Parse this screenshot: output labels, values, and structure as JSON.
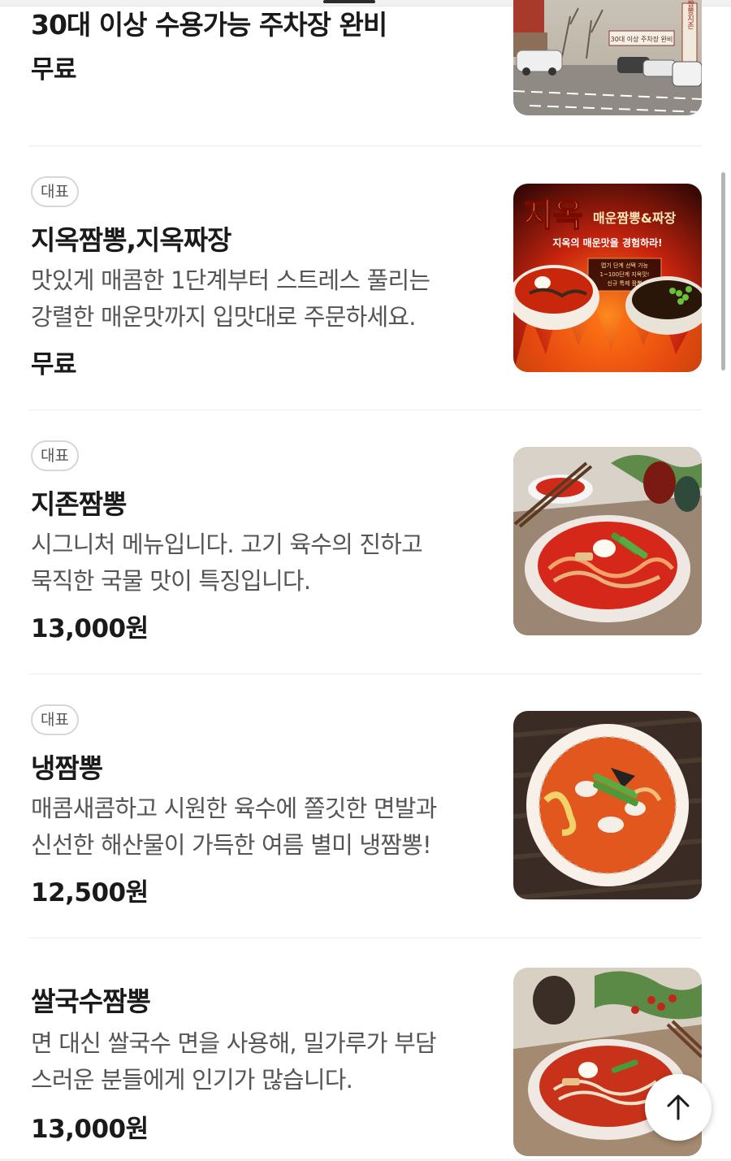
{
  "menu": {
    "items": [
      {
        "badge": "",
        "name": "30대 이상 수용가능 주차장 완비",
        "description": [],
        "price": "무료",
        "image": "parking-lot-photo"
      },
      {
        "badge": "대표",
        "name": "지옥짬뽕,지옥짜장",
        "description": [
          "맛있게 매콤한 1단계부터 스트레스 풀리는",
          "강렬한 매운맛까지 입맛대로 주문하세요."
        ],
        "price": "무료",
        "image": "hell-jjamppong-poster",
        "image_text": {
          "title": "지옥",
          "subtitle": "매운짬뽕&짜장",
          "tagline": "지옥의 매운맛을 경험하라!",
          "box_line1": "맵기 단계 선택 가능",
          "box_line2": "1~100단계 지옥맛!",
          "box_line3": "신규 특제 짬뽕"
        }
      },
      {
        "badge": "대표",
        "name": "지존짬뽕",
        "description": [
          "시그니처 메뉴입니다. 고기 육수의 진하고",
          "묵직한 국물 맛이 특징입니다."
        ],
        "price": "13,000원",
        "image": "jijon-jjamppong-photo"
      },
      {
        "badge": "대표",
        "name": "냉짬뽕",
        "description": [
          "매콤새콤하고 시원한 육수에 쫄깃한 면발과",
          "신선한 해산물이 가득한 여름 별미 냉짬뽕!"
        ],
        "price": "12,500원",
        "image": "cold-jjamppong-photo"
      },
      {
        "badge": "",
        "name": "쌀국수짬뽕",
        "description": [
          "면 대신 쌀국수 면을 사용해, 밀가루가 부담",
          "스러운 분들에게 인기가 많습니다."
        ],
        "price": "13,000원",
        "image": "rice-noodle-jjamppong-photo"
      }
    ]
  },
  "parking_sign": {
    "banner": "30대 이상 주차장 완비",
    "vertical_sign": "짬뽕지존"
  },
  "colors": {
    "text_primary": "#1a1a1a",
    "text_secondary": "#555555",
    "badge_border": "#d7d7d7",
    "divider": "#ececec"
  },
  "icons": {
    "scroll_top": "arrow-up-icon"
  }
}
